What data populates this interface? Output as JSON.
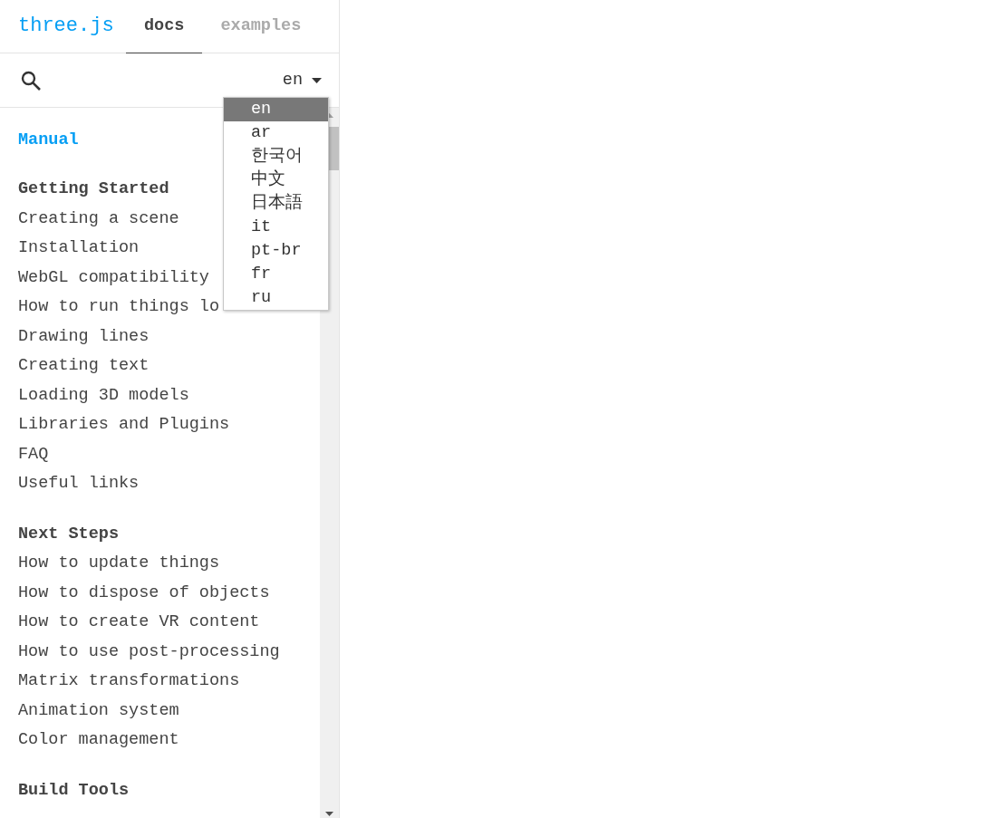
{
  "header": {
    "logo": "three.js",
    "tabs": [
      {
        "label": "docs",
        "selected": true
      },
      {
        "label": "examples",
        "selected": false
      }
    ]
  },
  "language_select": {
    "value": "en",
    "expanded": true,
    "options": [
      {
        "label": "en",
        "selected": true
      },
      {
        "label": "ar",
        "selected": false
      },
      {
        "label": "한국어",
        "selected": false
      },
      {
        "label": "中文",
        "selected": false
      },
      {
        "label": "日本語",
        "selected": false
      },
      {
        "label": "it",
        "selected": false
      },
      {
        "label": "pt-br",
        "selected": false
      },
      {
        "label": "fr",
        "selected": false
      },
      {
        "label": "ru",
        "selected": false
      }
    ]
  },
  "nav": {
    "title": "Manual",
    "sections": [
      {
        "heading": "Getting Started",
        "items": [
          "Creating a scene",
          "Installation",
          "WebGL compatibility",
          "How to run things lo",
          "Drawing lines",
          "Creating text",
          "Loading 3D models",
          "Libraries and Plugins",
          "FAQ",
          "Useful links"
        ]
      },
      {
        "heading": "Next Steps",
        "items": [
          "How to update things",
          "How to dispose of objects",
          "How to create VR content",
          "How to use post-processing",
          "Matrix transformations",
          "Animation system",
          "Color management"
        ]
      },
      {
        "heading": "Build Tools"
      }
    ]
  }
}
